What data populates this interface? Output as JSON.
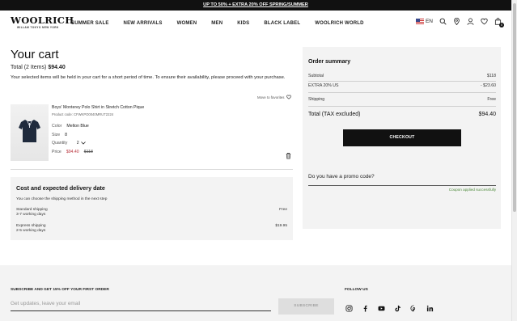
{
  "promo": {
    "text": "UP TO 50% + EXTRA 20% OFF SPRING/SUMMER"
  },
  "header": {
    "brand": "WOOLRICH",
    "tagline": "WILLAM  TOKYO  NEW YORK",
    "nav": [
      "SUMMER SALE",
      "NEW ARRIVALS",
      "WOMEN",
      "MEN",
      "KIDS",
      "BLACK LABEL",
      "WOOLRICH WORLD"
    ],
    "language": "EN",
    "bag_count": "0"
  },
  "cart": {
    "title": "Your cart",
    "total_label": "Total (2 Items)",
    "total_value": "$94.40",
    "note": "Your selected items will be held in your cart for a short period of time. To ensure their availability, please proceed with your purchase.",
    "move_to_favorites": "Move to favorites",
    "item": {
      "name": "Boys' Monterey Polo Shirt in Stretch Cotton Pique",
      "product_code": "Product code: CFWKPO0040MRUT2224",
      "color_label": "Color",
      "color_value": "Melton Blue",
      "size_label": "Size",
      "size_value": "8",
      "quantity_label": "Quantity",
      "quantity_value": "2",
      "price_label": "Price",
      "price_now": "$94.40",
      "price_old": "$118"
    }
  },
  "delivery": {
    "title": "Cost and expected delivery date",
    "subtitle": "You can choose the shipping method in the next step",
    "options": [
      {
        "name": "Standard shipping",
        "time": "3-7 working days",
        "price": "Free"
      },
      {
        "name": "Express shipping",
        "time": "2-5 working days",
        "price": "$19.95"
      }
    ]
  },
  "summary": {
    "title": "Order summary",
    "subtotal_label": "Subtotal",
    "subtotal_value": "$118",
    "discount_label": "EXTRA 20% US",
    "discount_value": "- $23.60",
    "shipping_label": "Shipping",
    "shipping_value": "Free",
    "total_label": "Total (TAX excluded)",
    "total_value": "$94.40",
    "checkout_label": "CHECKOUT",
    "promo_question": "Do you have a promo code?",
    "promo_status": "Coupon applied successfully"
  },
  "footer": {
    "subscribe_title": "SUBSCRIBE AND GET 15% OFF YOUR FIRST ORDER",
    "subscribe_placeholder": "Get updates, leave your email",
    "subscribe_button": "SUBSCRIBE",
    "follow_title": "FOLLOW US",
    "socials": [
      "instagram-icon",
      "facebook-icon",
      "youtube-icon",
      "tiktok-icon",
      "pinterest-icon",
      "linkedin-icon"
    ]
  },
  "colors": {
    "accent": "#111111",
    "sale_price": "#b8323b",
    "success": "#4d8a3a",
    "panel": "#f3f3f3"
  }
}
